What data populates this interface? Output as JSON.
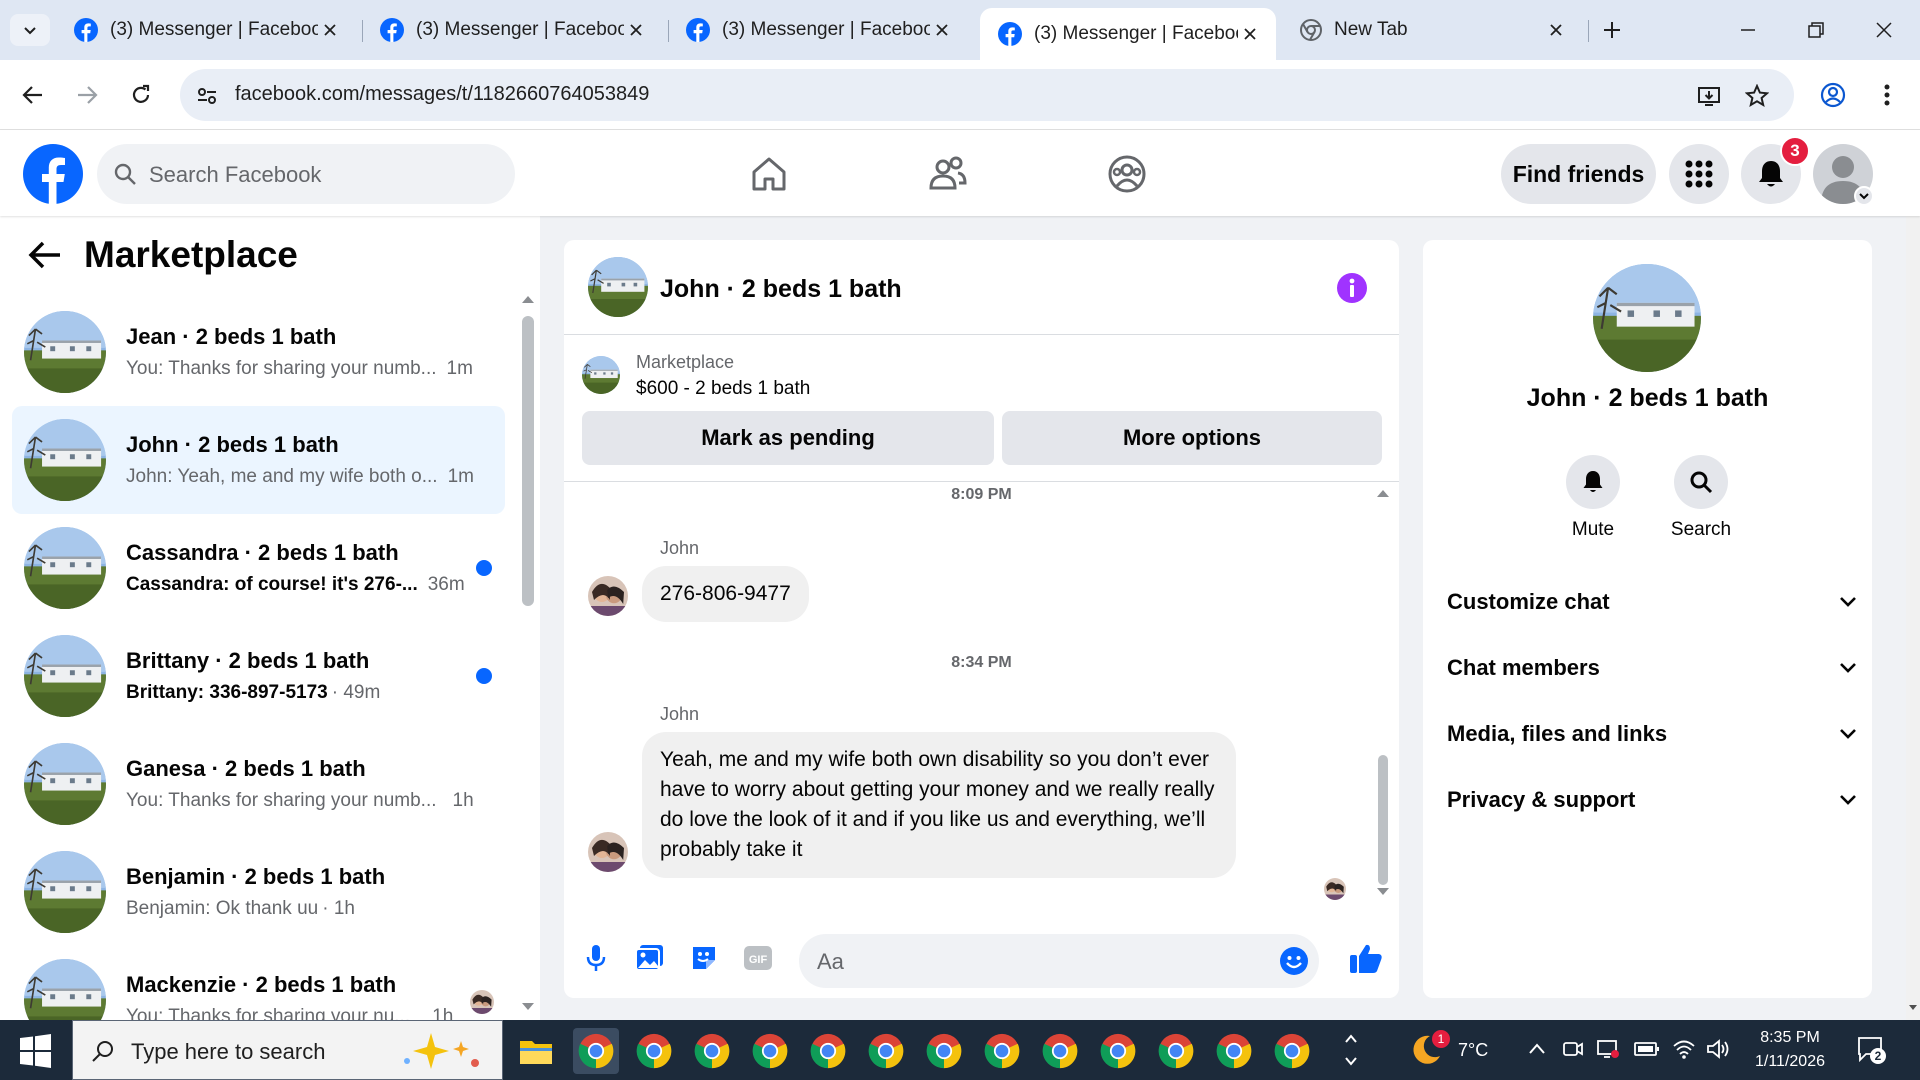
{
  "browser": {
    "tabs": [
      {
        "title": "(3) Messenger | Facebook",
        "active": false
      },
      {
        "title": "(3) Messenger | Facebook",
        "active": false
      },
      {
        "title": "(3) Messenger | Facebook",
        "active": false
      },
      {
        "title": "(3) Messenger | Facebook",
        "active": true
      },
      {
        "title": "New Tab",
        "active": false
      }
    ],
    "url": "facebook.com/messages/t/1182660764053849"
  },
  "fb": {
    "search_placeholder": "Search Facebook",
    "find_friends": "Find friends",
    "notification_count": "3"
  },
  "sidebar": {
    "title": "Marketplace",
    "conversations": [
      {
        "name": "Jean · 2 beds 1 bath",
        "preview": "You: Thanks for sharing your numb...",
        "time": "1m",
        "unread": false,
        "selected": false
      },
      {
        "name": "John · 2 beds 1 bath",
        "preview": "John: Yeah, me and my wife both o...",
        "time": "1m",
        "unread": false,
        "selected": true
      },
      {
        "name": "Cassandra · 2 beds 1 bath",
        "preview": "Cassandra: of course! it's 276-...",
        "time": "36m",
        "unread": true,
        "selected": false
      },
      {
        "name": "Brittany · 2 beds 1 bath",
        "preview": "Brittany: 336-897-5173",
        "time": "· 49m",
        "unread": true,
        "selected": false
      },
      {
        "name": "Ganesa · 2 beds 1 bath",
        "preview": "You: Thanks for sharing your numb...",
        "time": "1h",
        "unread": false,
        "selected": false
      },
      {
        "name": "Benjamin · 2 beds 1 bath",
        "preview": "Benjamin: Ok thank uu",
        "time": "· 1h",
        "unread": false,
        "selected": false
      },
      {
        "name": "Mackenzie · 2 beds 1 bath",
        "preview": "You: Thanks for sharing your nu...",
        "time": "1h",
        "unread": false,
        "selected": false
      }
    ]
  },
  "chat": {
    "title": "John · 2 beds 1 bath",
    "listing_source": "Marketplace",
    "listing": "$600 - 2 beds 1 bath",
    "mark_pending": "Mark as pending",
    "more_options": "More options",
    "messages": [
      {
        "time": "8:09 PM",
        "sender": "John",
        "text": "276-806-9477"
      },
      {
        "time": "8:34 PM",
        "sender": "John",
        "text": "Yeah, me and my wife both own disability so you don’t ever have to worry about getting your money and we really really do love the look of it and if you like us and everything, we’ll probably take it"
      }
    ],
    "composer_placeholder": "Aa"
  },
  "info_panel": {
    "name": "John · 2 beds 1 bath",
    "actions": [
      {
        "label": "Mute"
      },
      {
        "label": "Search"
      }
    ],
    "sections": [
      "Customize chat",
      "Chat members",
      "Media, files and links",
      "Privacy & support"
    ]
  },
  "taskbar": {
    "search_placeholder": "Type here to search",
    "weather": "7°C",
    "weather_badge": "1",
    "time": "8:35 PM",
    "date": "1/11/2026",
    "notif_count": "2"
  },
  "colors": {
    "fb_blue": "#0866ff",
    "selected_bg": "#ebf5ff",
    "notification_red": "#e41e3f",
    "info_purple": "#a033ff"
  }
}
